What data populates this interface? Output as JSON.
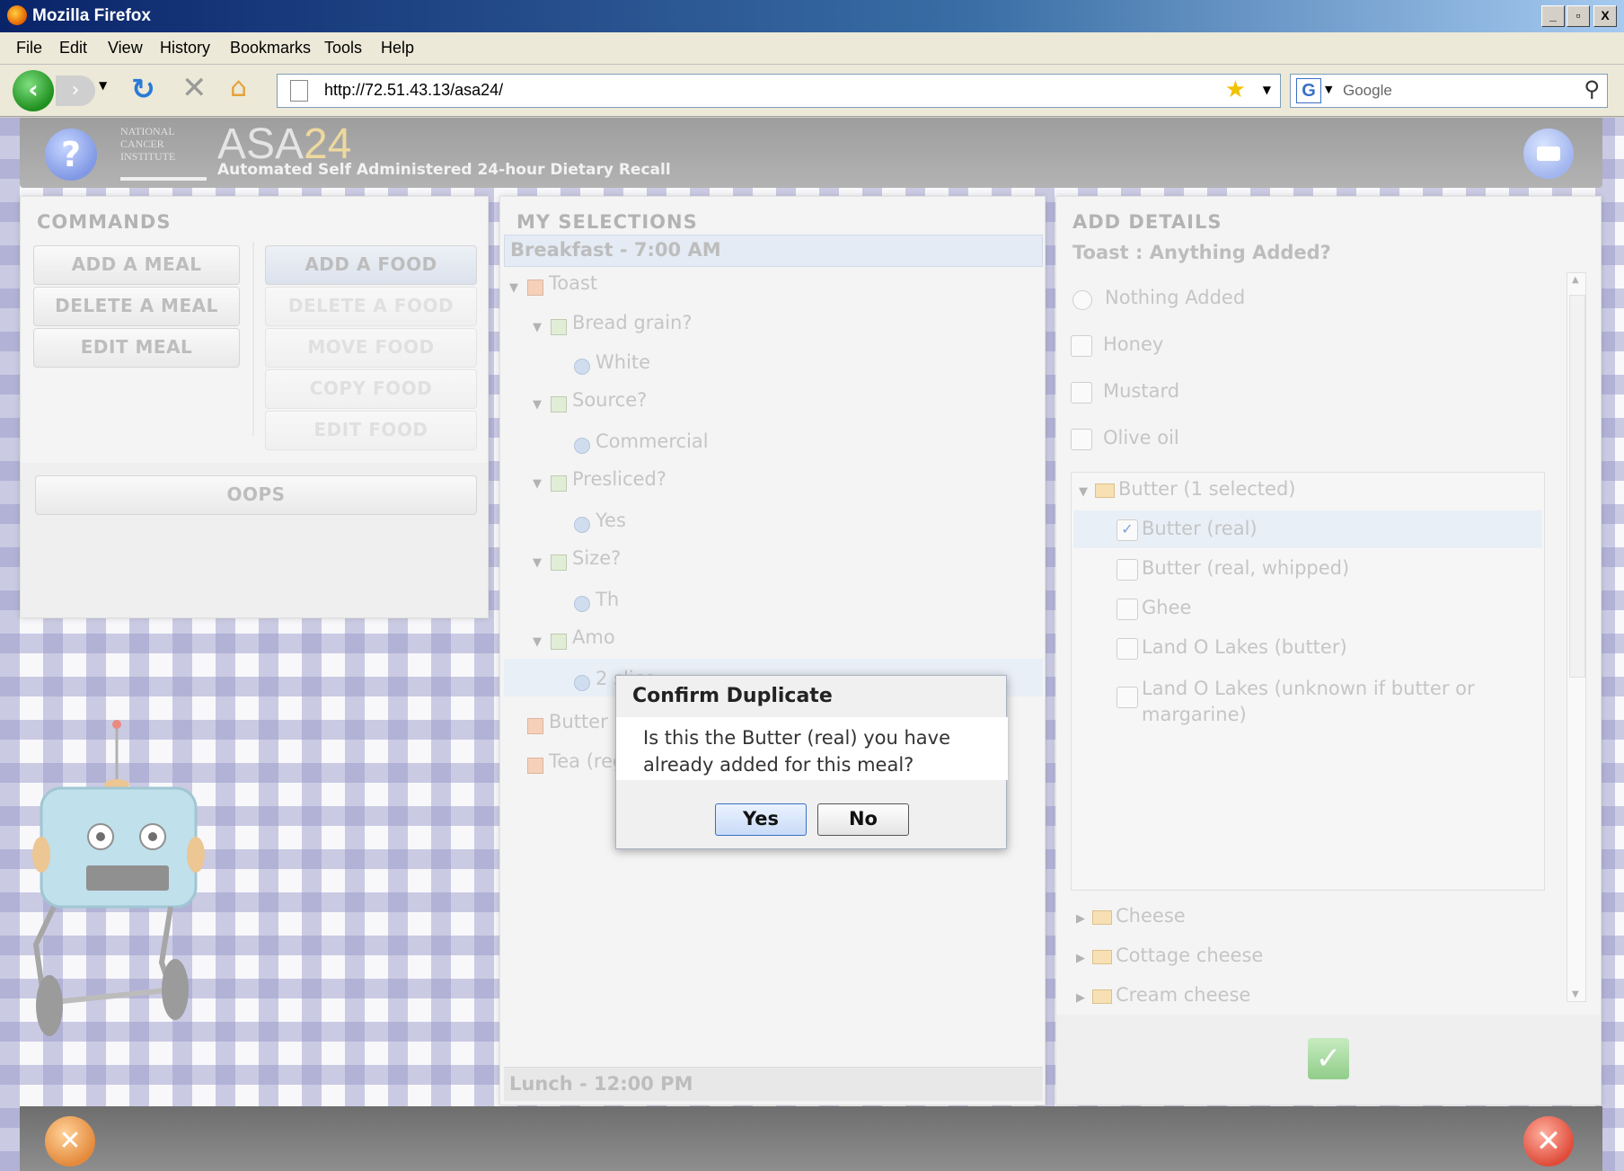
{
  "window": {
    "title": "Mozilla Firefox",
    "buttons": [
      "_",
      "▫",
      "X"
    ]
  },
  "menubar": {
    "items": [
      "File",
      "Edit",
      "View",
      "History",
      "Bookmarks",
      "Tools",
      "Help"
    ]
  },
  "navbar": {
    "url": "http://72.51.43.13/asa24/",
    "search_placeholder": "Google"
  },
  "app": {
    "logo_text": "NATIONAL CANCER INSTITUTE",
    "brand_prefix": "ASA",
    "brand_number": "24",
    "tagline": "Automated Self Administered 24-hour Dietary Recall"
  },
  "commands": {
    "title": "COMMANDS",
    "add_meal": "ADD A MEAL",
    "delete_meal": "DELETE A MEAL",
    "edit_meal": "EDIT MEAL",
    "add_food": "ADD A FOOD",
    "delete_food": "DELETE A FOOD",
    "move_food": "MOVE FOOD",
    "copy_food": "COPY FOOD",
    "edit_food": "EDIT FOOD",
    "oops": "OOPS"
  },
  "selections": {
    "title": "MY SELECTIONS",
    "meal_header": "Breakfast - 7:00 AM",
    "toast": "Toast",
    "bread_grain": "Bread grain?",
    "white": "White",
    "source": "Source?",
    "commercial": "Commercial",
    "presliced": "Presliced?",
    "yes": "Yes",
    "size": "Size?",
    "size_ans": "Th",
    "amount": "Amo",
    "amount_ans": "2 slice",
    "butter": "Butter (real)",
    "tea": "Tea (regular)",
    "next_meal": "Lunch - 12:00 PM"
  },
  "details": {
    "title": "ADD DETAILS",
    "question": "Toast : Anything Added?",
    "nothing_added": "Nothing Added",
    "honey": "Honey",
    "mustard": "Mustard",
    "olive_oil": "Olive oil",
    "butter_group": "Butter (1 selected)",
    "butter_items": [
      "Butter (real)",
      "Butter (real, whipped)",
      "Ghee",
      "Land O Lakes (butter)",
      "Land O Lakes (unknown if butter or margarine)"
    ],
    "cheese": "Cheese",
    "cottage_cheese": "Cottage cheese",
    "cream_cheese": "Cream cheese"
  },
  "dialog": {
    "title": "Confirm Duplicate",
    "message": "Is this the Butter (real) you have already added for this meal?",
    "yes": "Yes",
    "no": "No"
  },
  "colors": {
    "accent": "#3a6fc4",
    "brand_number": "#e3c36a"
  }
}
